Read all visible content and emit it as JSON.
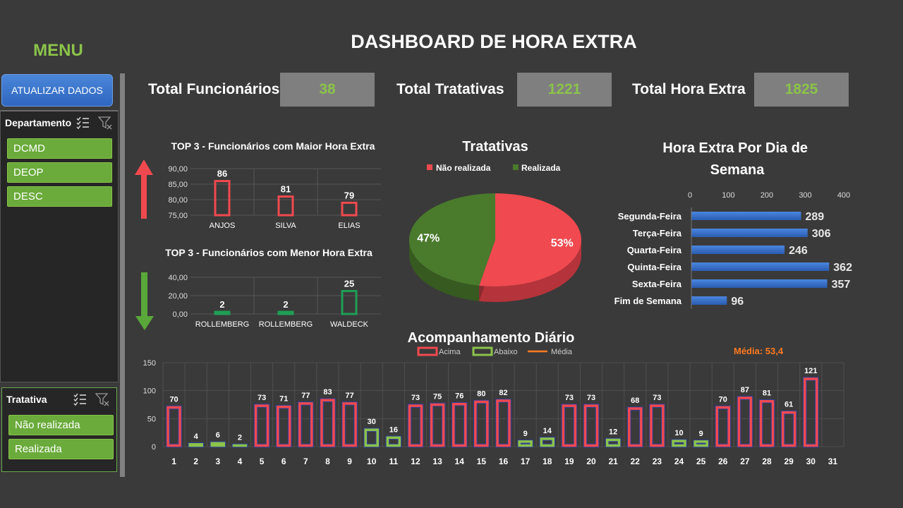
{
  "menu": {
    "title": "MENU",
    "update_button": "ATUALIZAR DADOS"
  },
  "dashboard_title": "DASHBOARD DE HORA EXTRA",
  "slicers": {
    "departamento": {
      "title": "Departamento",
      "items": [
        "DCMD",
        "DEOP",
        "DESC"
      ]
    },
    "tratativa": {
      "title": "Tratativa",
      "items": [
        "Não realizada",
        "Realizada"
      ]
    }
  },
  "kpis": [
    {
      "label": "Total Funcionários",
      "value": "38"
    },
    {
      "label": "Total Tratativas",
      "value": "1221"
    },
    {
      "label": "Total Hora Extra",
      "value": "1825"
    }
  ],
  "colors": {
    "green": "#8cc34a",
    "red": "#f0494f",
    "blue": "#3a74d0",
    "orange": "#ff7a1f",
    "pie_green": "#4a7a2c",
    "bar_green_dark": "#1f9e55"
  },
  "chart_data": [
    {
      "id": "top3",
      "type": "bar",
      "title": "TOP 3 - Funcionários com Maior Hora Extra",
      "categories": [
        "ANJOS",
        "SILVA",
        "ELIAS"
      ],
      "values": [
        86,
        81,
        79
      ],
      "ylim": [
        75,
        90
      ],
      "yticks": [
        "90,00",
        "85,00",
        "80,00",
        "75,00"
      ]
    },
    {
      "id": "bottom3",
      "type": "bar",
      "title": "TOP 3 - Funcionários com Menor Hora Extra",
      "categories": [
        "ROLLEMBERG",
        "ROLLEMBERG",
        "WALDECK"
      ],
      "values": [
        2,
        2,
        25
      ],
      "ylim": [
        0,
        40
      ],
      "yticks": [
        "40,00",
        "20,00",
        "0,00"
      ]
    },
    {
      "id": "pie",
      "type": "pie",
      "title": "Tratativas",
      "legend": [
        "Não realizada",
        "Realizada"
      ],
      "values": [
        53,
        47
      ],
      "labels": [
        "53%",
        "47%"
      ]
    },
    {
      "id": "weekday",
      "type": "bar",
      "title": "Hora Extra Por Dia de Semana",
      "categories": [
        "Segunda-Feira",
        "Terça-Feira",
        "Quarta-Feira",
        "Quinta-Feira",
        "Sexta-Feira",
        "Fim de Semana"
      ],
      "values": [
        289,
        306,
        246,
        362,
        357,
        96
      ],
      "xlim": [
        0,
        400
      ],
      "xticks": [
        "0",
        "100",
        "200",
        "300",
        "400"
      ]
    },
    {
      "id": "daily",
      "type": "bar",
      "title": "Acompanhamento Diário",
      "legend": [
        "Acima",
        "Abaixo",
        "Média"
      ],
      "media_label": "Média: 53,4",
      "media": 53.4,
      "ylim": [
        0,
        150
      ],
      "yticks": [
        "150",
        "100",
        "50",
        "0"
      ],
      "categories": [
        "1",
        "2",
        "3",
        "4",
        "5",
        "6",
        "7",
        "8",
        "9",
        "10",
        "11",
        "12",
        "13",
        "14",
        "15",
        "16",
        "17",
        "18",
        "19",
        "20",
        "21",
        "22",
        "23",
        "24",
        "25",
        "26",
        "27",
        "28",
        "29",
        "30",
        "31"
      ],
      "values": [
        70,
        4,
        6,
        2,
        73,
        71,
        77,
        83,
        77,
        30,
        16,
        73,
        75,
        76,
        80,
        82,
        9,
        14,
        73,
        73,
        12,
        68,
        73,
        10,
        9,
        70,
        87,
        81,
        61,
        121,
        null
      ]
    }
  ]
}
